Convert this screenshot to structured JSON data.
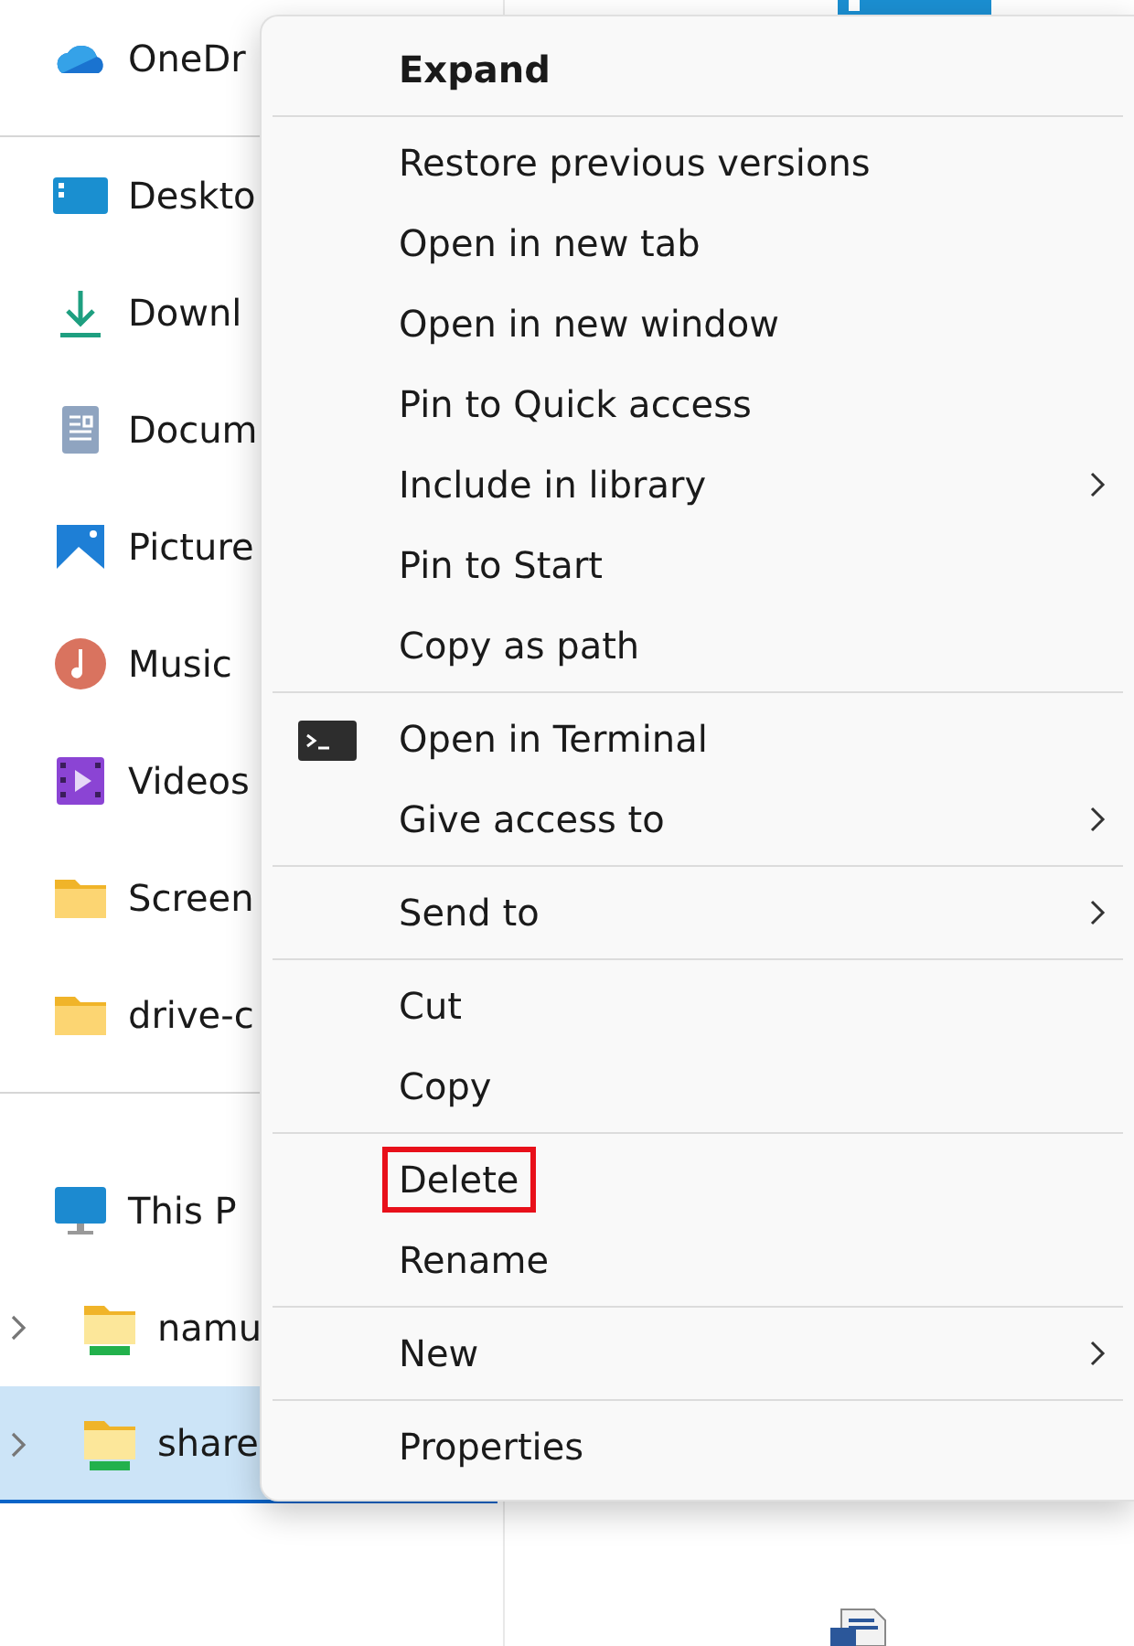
{
  "navigation_pane": {
    "groups": [
      {
        "items": [
          {
            "label": "OneDr",
            "kind": "onedrive",
            "selected": false,
            "expandable": false
          }
        ]
      },
      {
        "items": [
          {
            "label": "Deskto",
            "kind": "desktop",
            "selected": false,
            "expandable": false
          },
          {
            "label": "Downl",
            "kind": "downloads",
            "selected": false,
            "expandable": false
          },
          {
            "label": "Docum",
            "kind": "documents",
            "selected": false,
            "expandable": false
          },
          {
            "label": "Picture",
            "kind": "pictures",
            "selected": false,
            "expandable": false
          },
          {
            "label": "Music",
            "kind": "music",
            "selected": false,
            "expandable": false
          },
          {
            "label": "Videos",
            "kind": "videos",
            "selected": false,
            "expandable": false
          },
          {
            "label": "Screen",
            "kind": "folder",
            "selected": false,
            "expandable": false
          },
          {
            "label": "drive-c",
            "kind": "folder",
            "selected": false,
            "expandable": false
          }
        ]
      },
      {
        "items": [
          {
            "label": "This P",
            "kind": "pc",
            "selected": false,
            "expandable": false
          },
          {
            "label": "namu",
            "kind": "share",
            "selected": false,
            "expandable": true
          },
          {
            "label": "share",
            "kind": "share",
            "selected": true,
            "expandable": true
          }
        ]
      }
    ]
  },
  "context_menu": {
    "groups": [
      {
        "items": [
          {
            "label": "Expand",
            "default": true,
            "submenu": false,
            "highlighted": false
          }
        ]
      },
      {
        "items": [
          {
            "label": "Restore previous versions",
            "default": false,
            "submenu": false,
            "highlighted": false
          },
          {
            "label": "Open in new tab",
            "default": false,
            "submenu": false,
            "highlighted": false
          },
          {
            "label": "Open in new window",
            "default": false,
            "submenu": false,
            "highlighted": false
          },
          {
            "label": "Pin to Quick access",
            "default": false,
            "submenu": false,
            "highlighted": false
          },
          {
            "label": "Include in library",
            "default": false,
            "submenu": true,
            "highlighted": false
          },
          {
            "label": "Pin to Start",
            "default": false,
            "submenu": false,
            "highlighted": false
          },
          {
            "label": "Copy as path",
            "default": false,
            "submenu": false,
            "highlighted": false
          }
        ]
      },
      {
        "items": [
          {
            "label": "Open in Terminal",
            "kind": "terminal",
            "default": false,
            "submenu": false,
            "highlighted": false
          },
          {
            "label": "Give access to",
            "default": false,
            "submenu": true,
            "highlighted": false
          }
        ]
      },
      {
        "items": [
          {
            "label": "Send to",
            "default": false,
            "submenu": true,
            "highlighted": false
          }
        ]
      },
      {
        "items": [
          {
            "label": "Cut",
            "default": false,
            "submenu": false,
            "highlighted": false
          },
          {
            "label": "Copy",
            "default": false,
            "submenu": false,
            "highlighted": false
          }
        ]
      },
      {
        "items": [
          {
            "label": "Delete",
            "default": false,
            "submenu": false,
            "highlighted": true
          },
          {
            "label": "Rename",
            "default": false,
            "submenu": false,
            "highlighted": false
          }
        ]
      },
      {
        "items": [
          {
            "label": "New",
            "default": false,
            "submenu": true,
            "highlighted": false
          }
        ]
      },
      {
        "items": [
          {
            "label": "Properties",
            "default": false,
            "submenu": false,
            "highlighted": false
          }
        ]
      }
    ]
  }
}
